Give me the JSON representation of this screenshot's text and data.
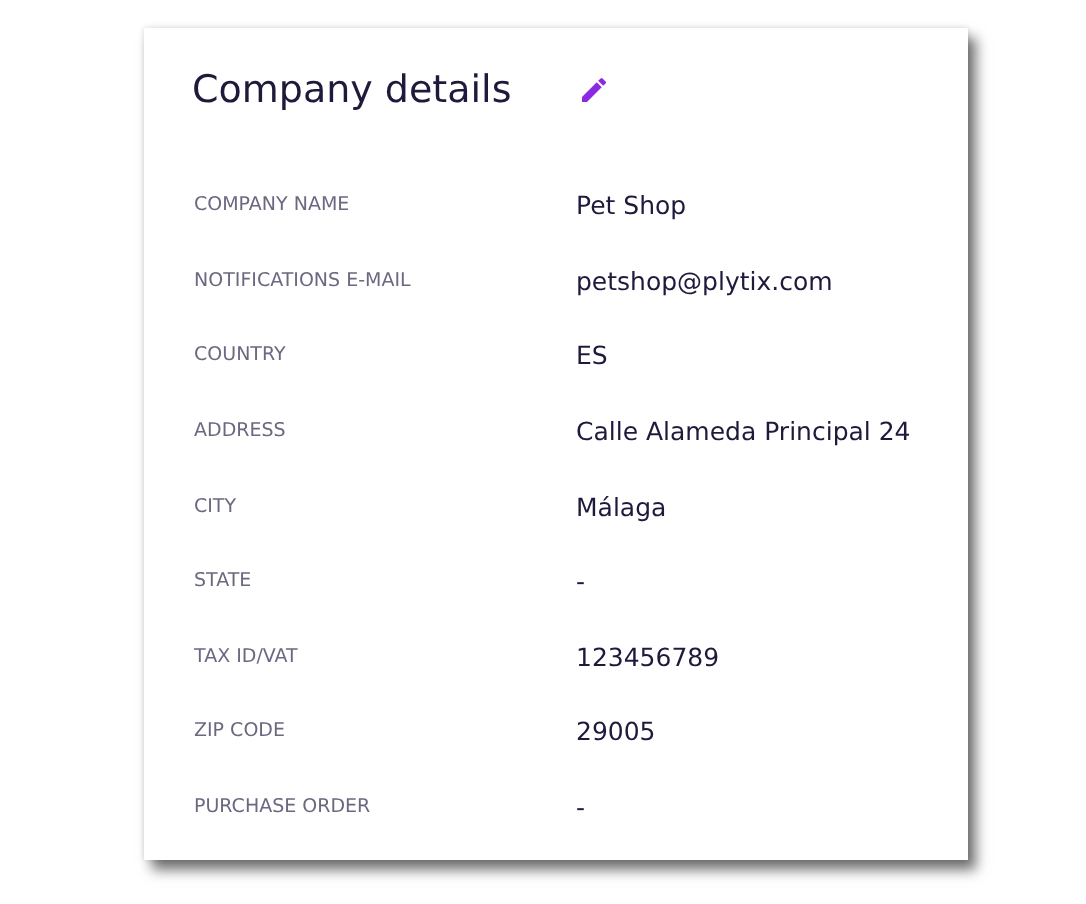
{
  "card": {
    "title": "Company details",
    "fields": [
      {
        "label": "COMPANY NAME",
        "value": "Pet Shop"
      },
      {
        "label": "NOTIFICATIONS E-MAIL",
        "value": "petshop@plytix.com"
      },
      {
        "label": "COUNTRY",
        "value": "ES"
      },
      {
        "label": "ADDRESS",
        "value": "Calle Alameda Principal 24"
      },
      {
        "label": "CITY",
        "value": "Málaga"
      },
      {
        "label": "STATE",
        "value": "-"
      },
      {
        "label": "TAX ID/VAT",
        "value": "123456789"
      },
      {
        "label": "ZIP CODE",
        "value": "29005"
      },
      {
        "label": "PURCHASE ORDER",
        "value": "-"
      }
    ]
  }
}
